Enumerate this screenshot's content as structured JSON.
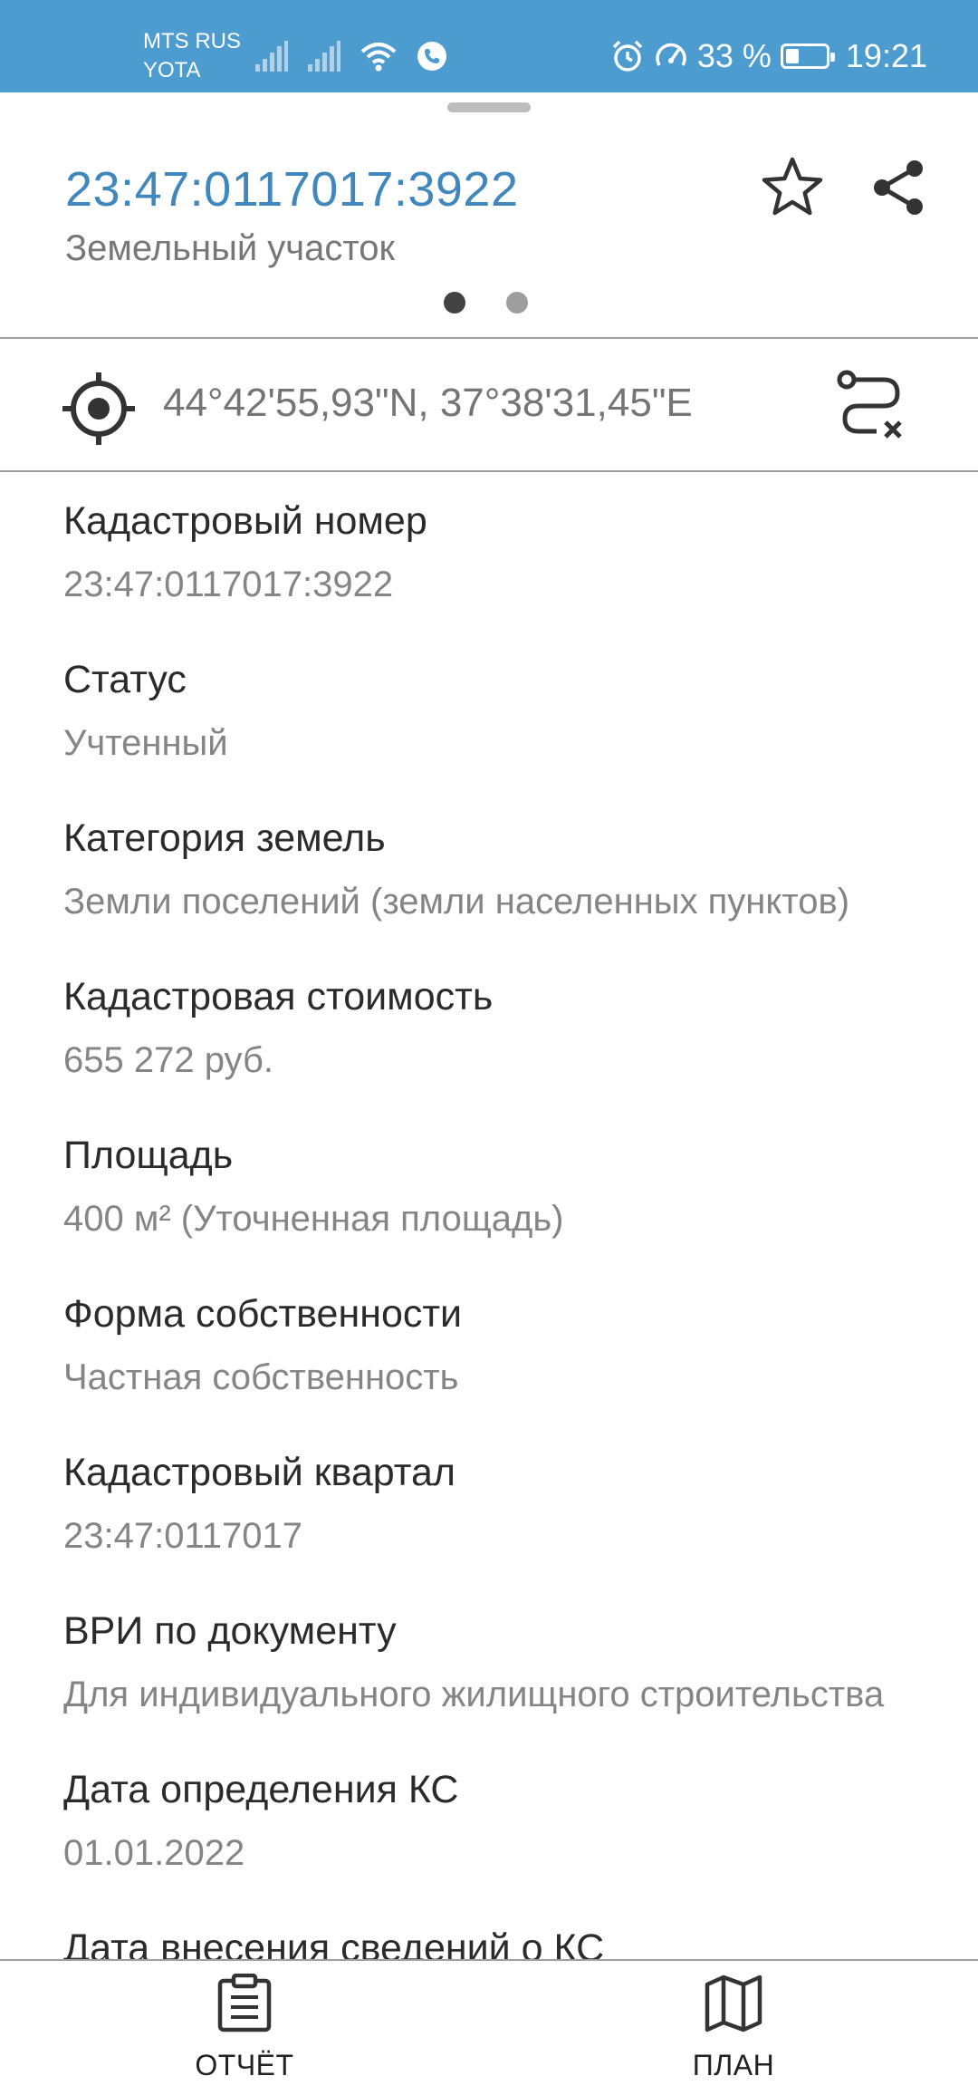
{
  "status_bar": {
    "carrier_1": "MTS RUS",
    "carrier_2": "YOTA",
    "battery": "33 %",
    "time": "19:21",
    "battery_level": 0.33,
    "icons": [
      "signal-icon",
      "signal-icon",
      "wifi-icon",
      "call-icon",
      "alarm-icon",
      "speedometer-icon",
      "battery-icon"
    ]
  },
  "header": {
    "title": "23:47:0117017:3922",
    "subtitle": "Земельный участок",
    "page_dots": 2,
    "active_page": 0
  },
  "location": {
    "coordinates": "44°42'55,93\"N, 37°38'31,45\"E"
  },
  "fields": [
    {
      "label": "Кадастровый номер",
      "value": "23:47:0117017:3922"
    },
    {
      "label": "Статус",
      "value": "Учтенный"
    },
    {
      "label": "Категория земель",
      "value": "Земли поселений (земли населенных пунктов)"
    },
    {
      "label": "Кадастровая стоимость",
      "value": "655 272 руб."
    },
    {
      "label": "Площадь",
      "value": "400 м² (Уточненная площадь)"
    },
    {
      "label": "Форма собственности",
      "value": "Частная собственность"
    },
    {
      "label": "Кадастровый квартал",
      "value": "23:47:0117017"
    },
    {
      "label": "ВРИ по документу",
      "value": "Для индивидуального жилищного строительства"
    },
    {
      "label": "Дата определения КС",
      "value": "01.01.2022"
    },
    {
      "label": "Дата внесения сведений о КС",
      "value": ""
    }
  ],
  "bottom_nav": {
    "report_label": "ОТЧЁТ",
    "plan_label": "ПЛАН"
  },
  "colors": {
    "status_bar": "#4d9cd0",
    "title": "#3f87bd",
    "dot_active": "#424242",
    "dot_inactive": "#9e9e9e"
  }
}
